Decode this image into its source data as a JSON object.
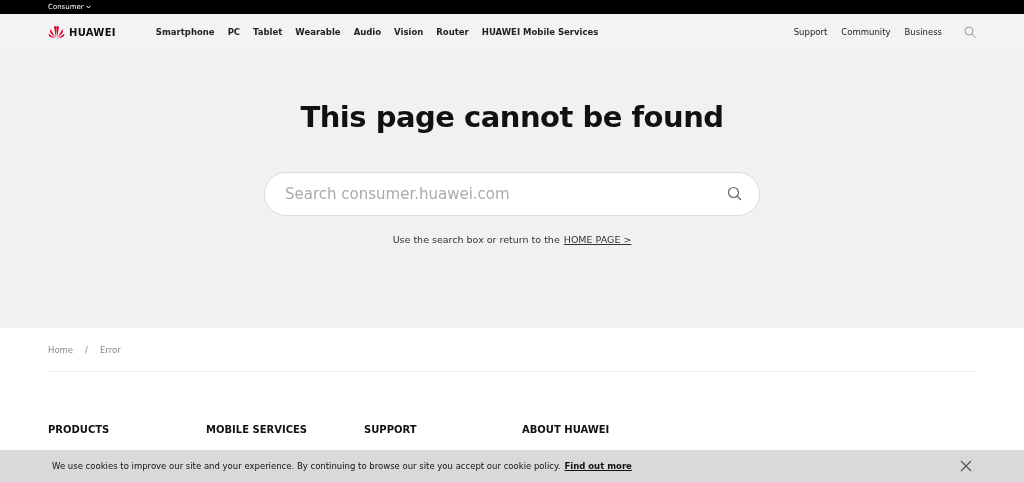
{
  "top_bar": {
    "region": "Consumer"
  },
  "nav": {
    "brand": "HUAWEI",
    "items": [
      "Smartphone",
      "PC",
      "Tablet",
      "Wearable",
      "Audio",
      "Vision",
      "Router",
      "HUAWEI Mobile Services"
    ],
    "right_items": [
      "Support",
      "Community",
      "Business"
    ]
  },
  "hero": {
    "title": "This page cannot be found",
    "search": {
      "placeholder": "Search consumer.huawei.com"
    },
    "hint": "Use the search box or return to the",
    "home_link": "HOME PAGE >"
  },
  "breadcrumb": [
    "Home",
    "Error"
  ],
  "breadcrumb_separator": "/",
  "footer": {
    "columns": [
      "PRODUCTS",
      "MOBILE SERVICES",
      "SUPPORT",
      "ABOUT HUAWEI"
    ]
  },
  "cookie_banner": {
    "text": "We use cookies to improve our site and your experience. By continuing to browse our site you accept our cookie policy.",
    "link": "Find out more"
  }
}
